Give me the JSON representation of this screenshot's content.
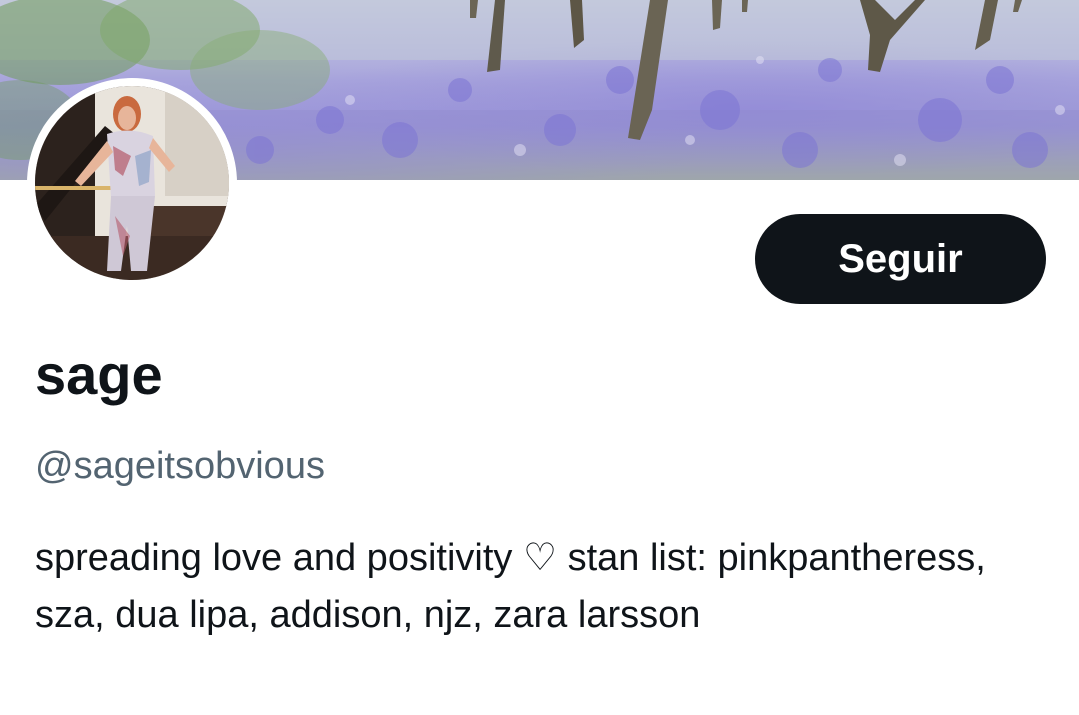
{
  "profile": {
    "display_name": "sage",
    "handle": "@sageitsobvious",
    "bio": "spreading love and positivity ♡ stan list: pinkpantheress, sza, dua lipa, addison, njz, zara larsson"
  },
  "actions": {
    "follow_label": "Seguir"
  },
  "colors": {
    "button_bg": "#0f1419",
    "button_text": "#ffffff",
    "primary_text": "#0f1419",
    "secondary_text": "#536471"
  }
}
